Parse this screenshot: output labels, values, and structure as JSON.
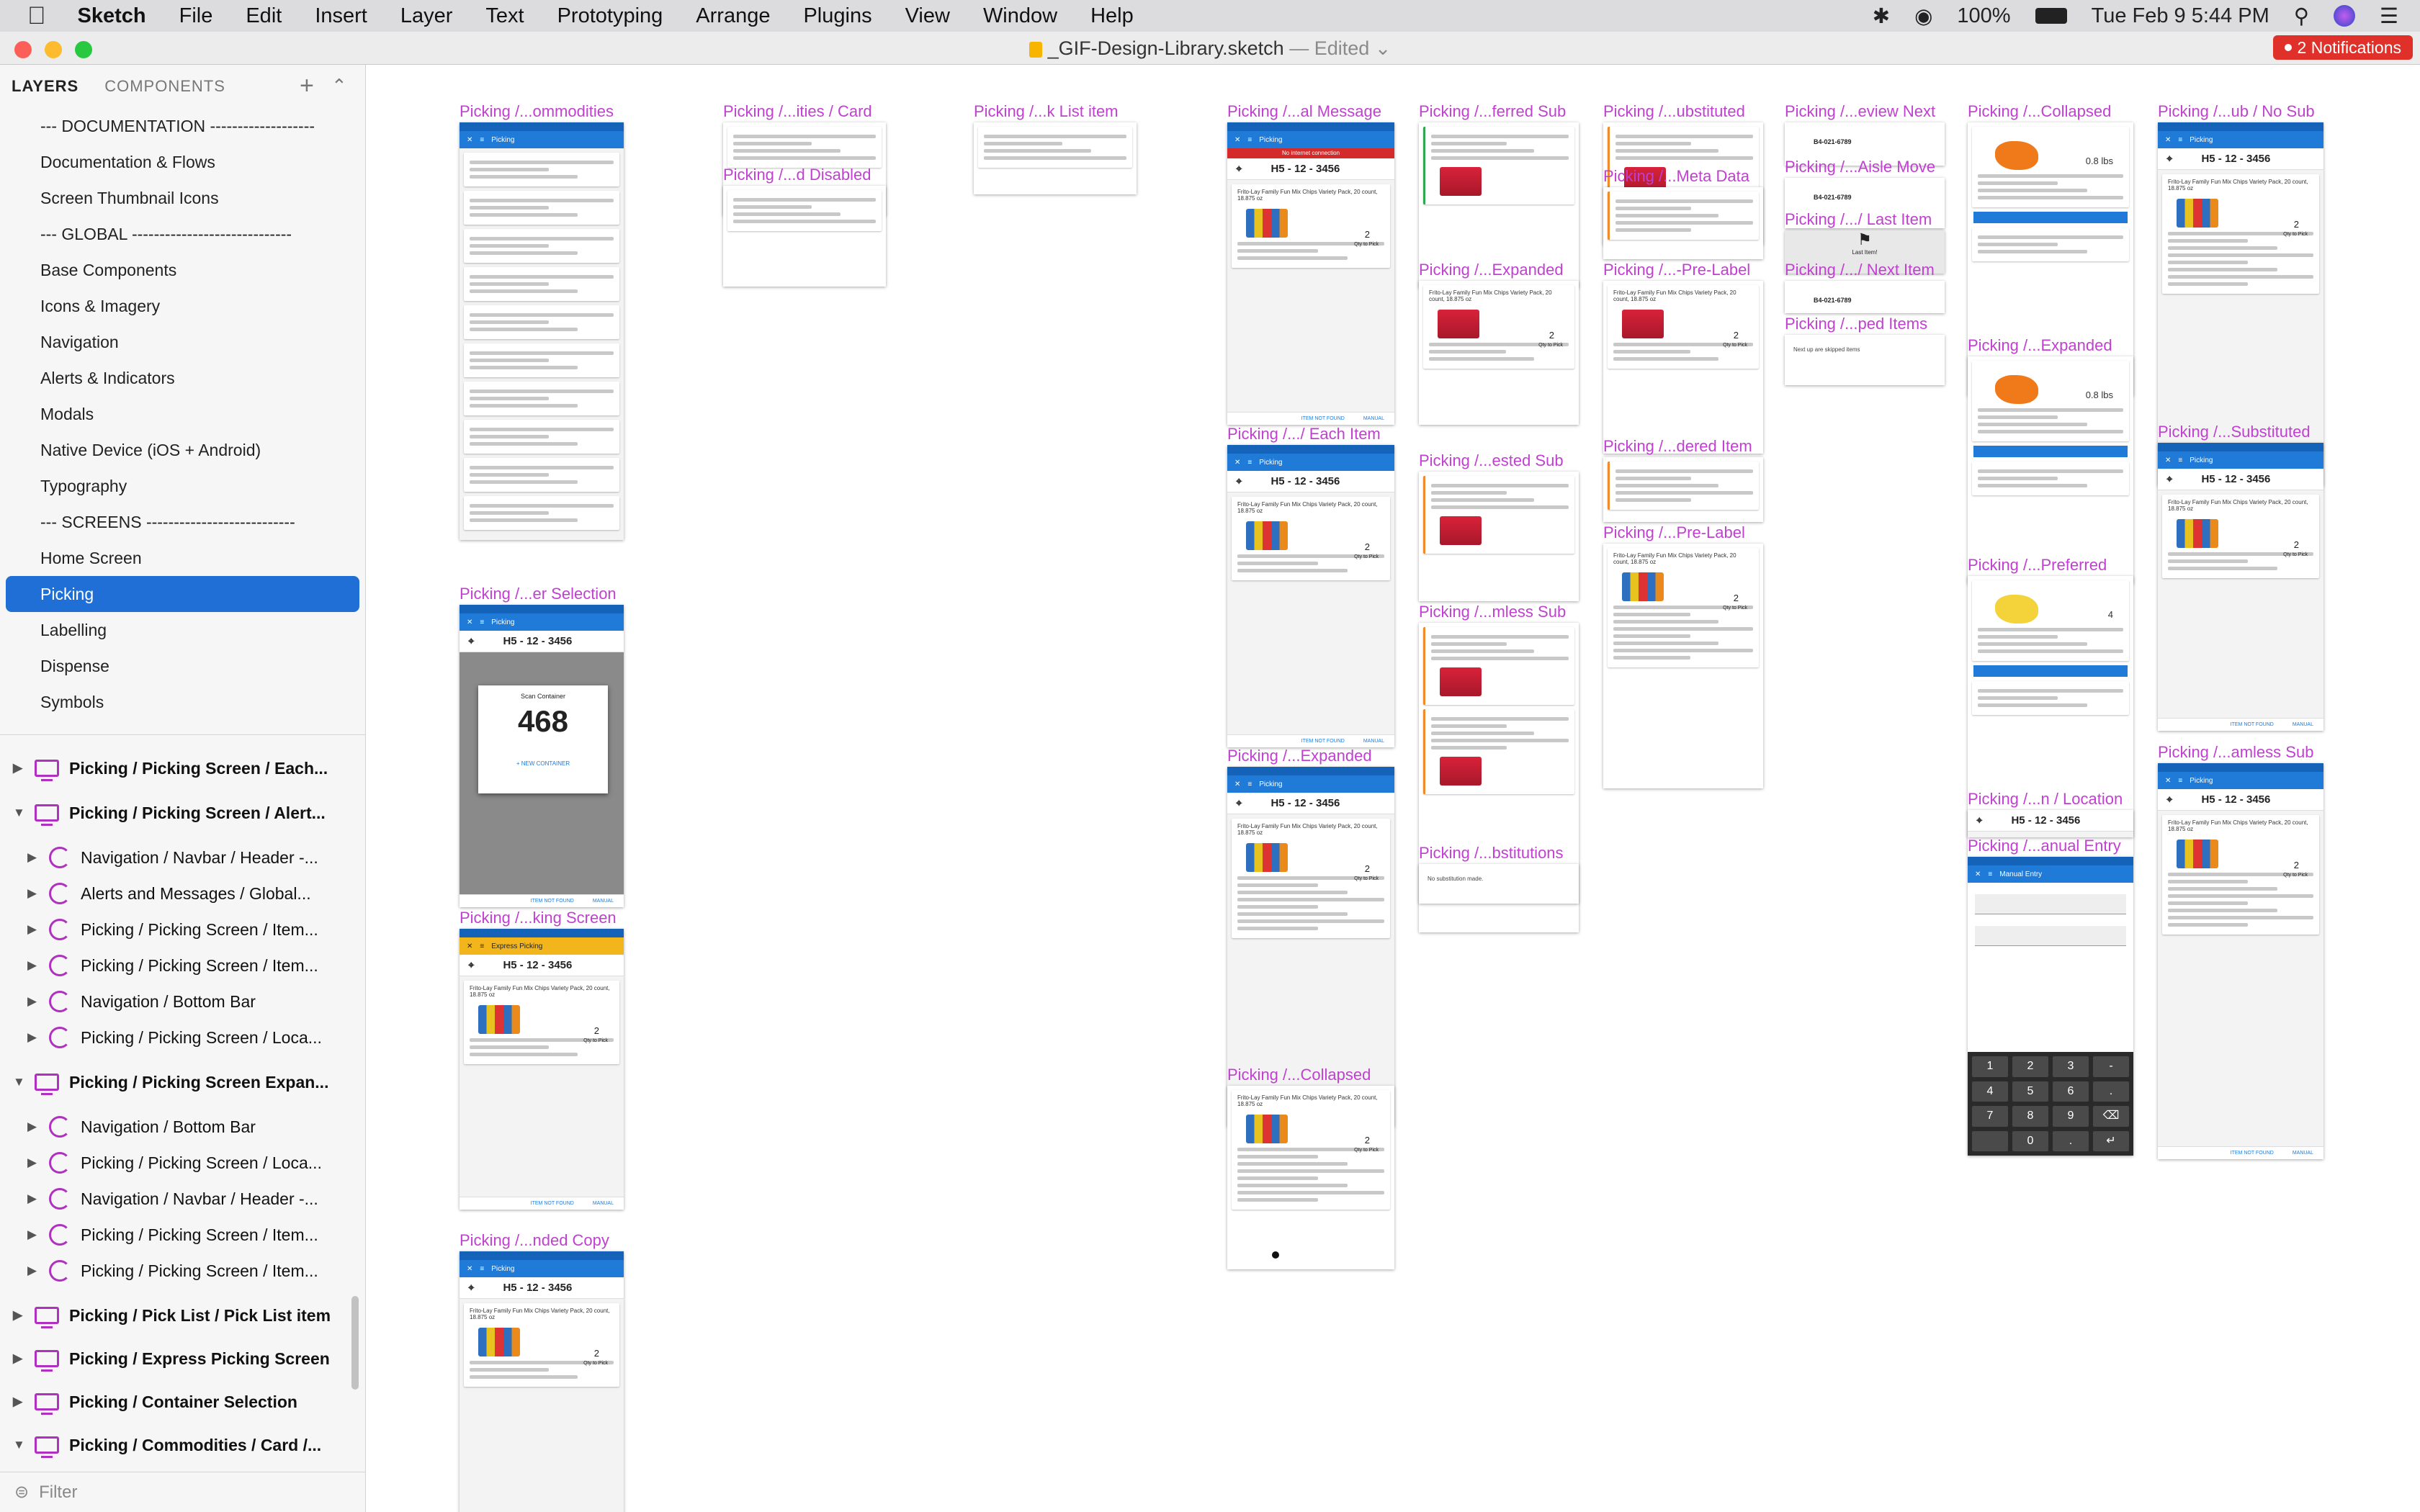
{
  "menubar": {
    "apple": "",
    "app": "Sketch",
    "items": [
      "File",
      "Edit",
      "Insert",
      "Layer",
      "Text",
      "Prototyping",
      "Arrange",
      "Plugins",
      "View",
      "Window",
      "Help"
    ],
    "battery": "100%",
    "clock": "Tue Feb 9  5:44 PM"
  },
  "window": {
    "doc_title": "_GIF-Design-Library.sketch",
    "doc_status": "— Edited",
    "notifications": "2 Notifications"
  },
  "sidebar": {
    "tab_layers": "LAYERS",
    "tab_components": "COMPONENTS",
    "pages": [
      "--- DOCUMENTATION -------------------",
      "Documentation & Flows",
      "Screen Thumbnail Icons",
      "--- GLOBAL -----------------------------",
      "Base Components",
      "Icons & Imagery",
      "Navigation",
      "Alerts & Indicators",
      "Modals",
      "Native Device (iOS + Android)",
      "Typography",
      "--- SCREENS ---------------------------",
      "Home Screen",
      "Picking",
      "Labelling",
      "Dispense",
      "Symbols"
    ],
    "selected_page": "Picking",
    "layers": [
      {
        "label": "Picking / Picking Screen / Each...",
        "kind": "artboard",
        "indent": 0,
        "expanded": false
      },
      {
        "label": "Picking / Picking Screen / Alert...",
        "kind": "artboard",
        "indent": 0,
        "expanded": true
      },
      {
        "label": "Navigation / Navbar / Header -...",
        "kind": "symbol",
        "indent": 1,
        "expanded": false
      },
      {
        "label": "Alerts and Messages / Global...",
        "kind": "symbol",
        "indent": 1,
        "expanded": false
      },
      {
        "label": "Picking / Picking Screen / Item...",
        "kind": "symbol",
        "indent": 1,
        "expanded": false
      },
      {
        "label": "Picking / Picking Screen / Item...",
        "kind": "symbol",
        "indent": 1,
        "expanded": false
      },
      {
        "label": "Navigation / Bottom Bar",
        "kind": "symbol",
        "indent": 1,
        "expanded": false
      },
      {
        "label": "Picking / Picking Screen / Loca...",
        "kind": "symbol",
        "indent": 1,
        "expanded": false
      },
      {
        "label": "Picking / Picking Screen Expan...",
        "kind": "artboard",
        "indent": 0,
        "expanded": true
      },
      {
        "label": "Navigation / Bottom Bar",
        "kind": "symbol",
        "indent": 1,
        "expanded": false
      },
      {
        "label": "Picking / Picking Screen / Loca...",
        "kind": "symbol",
        "indent": 1,
        "expanded": false
      },
      {
        "label": "Navigation / Navbar / Header -...",
        "kind": "symbol",
        "indent": 1,
        "expanded": false
      },
      {
        "label": "Picking / Picking Screen / Item...",
        "kind": "symbol",
        "indent": 1,
        "expanded": false
      },
      {
        "label": "Picking / Picking Screen / Item...",
        "kind": "symbol",
        "indent": 1,
        "expanded": false
      },
      {
        "label": "Picking / Pick List / Pick List item",
        "kind": "artboard",
        "indent": 0,
        "expanded": false
      },
      {
        "label": "Picking / Express Picking Screen",
        "kind": "artboard",
        "indent": 0,
        "expanded": false
      },
      {
        "label": "Picking / Container Selection",
        "kind": "artboard",
        "indent": 0,
        "expanded": false
      },
      {
        "label": "Picking / Commodities / Card /...",
        "kind": "artboard",
        "indent": 0,
        "expanded": true
      }
    ],
    "filter_placeholder": "Filter"
  },
  "canvas": {
    "artboards": [
      {
        "label": "Picking /...ommodities",
        "kind": "commodities"
      },
      {
        "label": "Picking /...er Selection",
        "kind": "container",
        "scan_title": "Scan Container",
        "scan_number": "468",
        "new_container": "+ NEW CONTAINER"
      },
      {
        "label": "Picking /...king Screen",
        "kind": "express",
        "title": "Express Picking"
      },
      {
        "label": "Picking /...nded Copy",
        "kind": "picking"
      },
      {
        "label": "Picking /...ities / Card",
        "kind": "card"
      },
      {
        "label": "Picking /...d Disabled",
        "kind": "card"
      },
      {
        "label": "Picking /...k List item",
        "kind": "card"
      },
      {
        "label": "Picking /...al Message",
        "kind": "picking",
        "alert": "No internet connection"
      },
      {
        "label": "Picking /.../ Each Item",
        "kind": "picking"
      },
      {
        "label": "Picking /...Expanded",
        "kind": "picking"
      },
      {
        "label": "Picking /...Collapsed",
        "kind": "item"
      },
      {
        "label": "Picking /...ferred Sub",
        "kind": "sub"
      },
      {
        "label": "Picking /...Expanded",
        "kind": "item"
      },
      {
        "label": "Picking /...ested Sub",
        "kind": "sub"
      },
      {
        "label": "Picking /...mless Sub",
        "kind": "sub"
      },
      {
        "label": "Picking /...bstitutions",
        "kind": "note",
        "note": "No substitution made."
      },
      {
        "label": "Picking /...ubstituted",
        "kind": "sub"
      },
      {
        "label": "Picking /...Meta Data",
        "kind": "meta"
      },
      {
        "label": "Picking /...-Pre-Label",
        "kind": "item"
      },
      {
        "label": "Picking /...dered Item",
        "kind": "meta"
      },
      {
        "label": "Picking /...Pre-Label",
        "kind": "item"
      },
      {
        "label": "Picking /...eview Next",
        "kind": "next",
        "code": "B4-021-6789"
      },
      {
        "label": "Picking /...Aisle Move",
        "kind": "next",
        "code": "B4-021-6789"
      },
      {
        "label": "Picking /.../ Last Item",
        "kind": "last",
        "text": "Last Item!"
      },
      {
        "label": "Picking /.../ Next Item",
        "kind": "next",
        "code": "B4-021-6789"
      },
      {
        "label": "Picking /...ped Items",
        "kind": "note",
        "note": "Next up are skipped items"
      },
      {
        "label": "Picking /...Collapsed",
        "kind": "weigh"
      },
      {
        "label": "Picking /...Expanded",
        "kind": "weigh"
      },
      {
        "label": "Picking /...Preferred",
        "kind": "weigh"
      },
      {
        "label": "Picking /...n / Location",
        "kind": "location"
      },
      {
        "label": "Picking /...anual Entry",
        "kind": "manual",
        "title": "Manual Entry"
      },
      {
        "label": "Picking /...ub / No Sub",
        "kind": "picking"
      },
      {
        "label": "Picking /...Substituted",
        "kind": "picking"
      },
      {
        "label": "Picking /...amless Sub",
        "kind": "picking"
      }
    ],
    "screen_title": "Picking",
    "location": "H5 - 12 - 3456",
    "product": "Frito-Lay Family Fun Mix Chips Variety Pack, 20 count, 18.875 oz",
    "qty_to_pick": "2",
    "qty_caption": "Qty to Pick",
    "btm_not_found": "ITEM NOT FOUND",
    "btm_manual": "MANUAL",
    "weights": {
      "a": "0.8 lbs",
      "b": "0.8 lbs",
      "c": "4"
    },
    "keypad": [
      "1",
      "2",
      "3",
      "-",
      "4",
      "5",
      "6",
      ".",
      "7",
      "8",
      "9",
      "⌫",
      "",
      "0",
      ".",
      "↵"
    ]
  }
}
